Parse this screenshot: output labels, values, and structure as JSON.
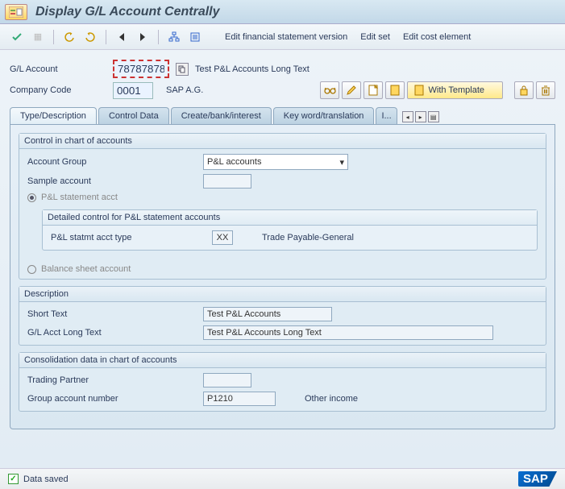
{
  "title": "Display G/L Account Centrally",
  "toolbar": {
    "edit_fsv": "Edit financial statement version",
    "edit_set": "Edit set",
    "edit_cost": "Edit cost element"
  },
  "header": {
    "gl_label": "G/L Account",
    "gl_value": "78787878",
    "gl_long_text": "Test P&L Accounts Long Text",
    "cc_label": "Company Code",
    "cc_value": "0001",
    "cc_name": "SAP A.G.",
    "with_template": "With Template"
  },
  "tabs": {
    "t1": "Type/Description",
    "t2": "Control Data",
    "t3": "Create/bank/interest",
    "t4": "Key word/translation",
    "t5": "I..."
  },
  "ctrl_chart": {
    "title": "Control in chart of accounts",
    "acct_group_label": "Account Group",
    "acct_group_value": "P&L accounts",
    "sample_label": "Sample account",
    "pl_radio": "P&L statement acct",
    "detail_title": "Detailed control for P&L statement accounts",
    "pl_type_label": "P&L statmt acct type",
    "pl_type_value": "XX",
    "pl_type_desc": "Trade Payable-General",
    "bs_radio": "Balance sheet account"
  },
  "desc": {
    "title": "Description",
    "short_label": "Short Text",
    "short_value": "Test P&L Accounts",
    "long_label": "G/L Acct Long Text",
    "long_value": "Test P&L Accounts Long Text"
  },
  "consol": {
    "title": "Consolidation data in chart of accounts",
    "tp_label": "Trading Partner",
    "gan_label": "Group account number",
    "gan_value": "P1210",
    "gan_desc": "Other income"
  },
  "status": {
    "msg": "Data saved",
    "logo": "SAP"
  }
}
